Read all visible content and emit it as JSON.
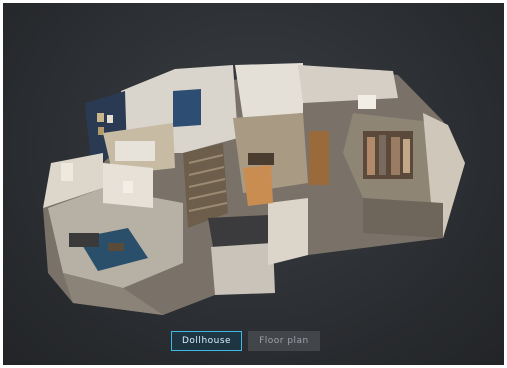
{
  "viewer": {
    "view_modes": [
      {
        "label": "Dollhouse",
        "active": true
      },
      {
        "label": "Floor plan",
        "active": false
      }
    ]
  },
  "colors": {
    "background": "#2c2f33",
    "active_outline": "#3fb8e8",
    "inactive_button": "#464a4f"
  },
  "icons": [
    "dollhouse-3d-model"
  ]
}
